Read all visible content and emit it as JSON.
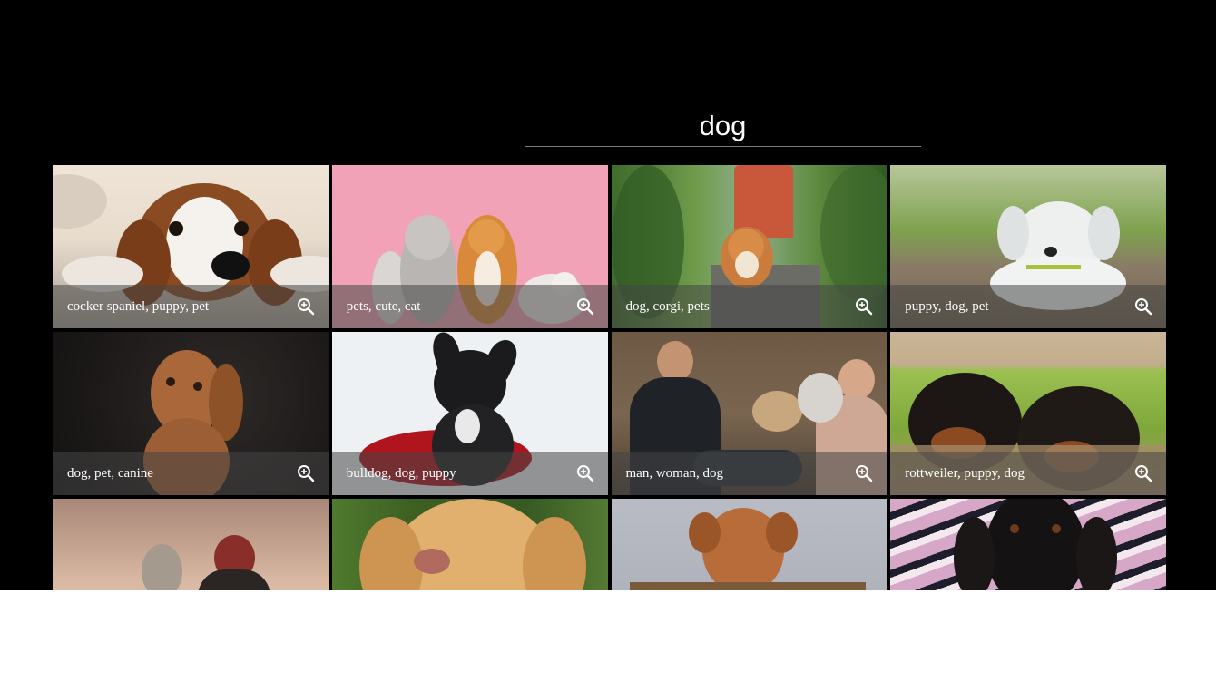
{
  "search": {
    "value": "dog",
    "placeholder": ""
  },
  "results": [
    {
      "tags": "cocker spaniel, puppy, pet"
    },
    {
      "tags": "pets, cute, cat"
    },
    {
      "tags": "dog, corgi, pets"
    },
    {
      "tags": "puppy, dog, pet"
    },
    {
      "tags": "dog, pet, canine"
    },
    {
      "tags": "bulldog, dog, puppy"
    },
    {
      "tags": "man, woman, dog"
    },
    {
      "tags": "rottweiler, puppy, dog"
    }
  ],
  "icons": {
    "zoom": "zoom-in-icon"
  }
}
